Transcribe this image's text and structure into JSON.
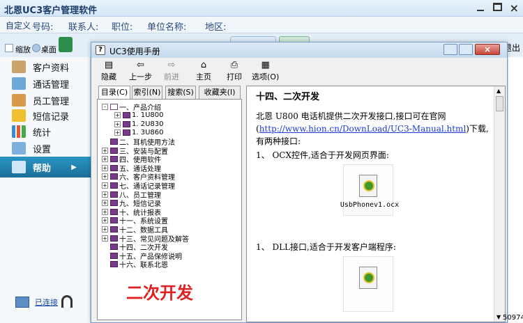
{
  "app": {
    "title": "北恩UC3客户管理软件"
  },
  "search": {
    "customize": "自定义",
    "fields": [
      "号码:",
      "联系人:",
      "职位:",
      "单位名称:",
      "地区:"
    ]
  },
  "toolbar": {
    "zoom_label": "缩放",
    "desktop_label": "桌面",
    "exit_label": "退出"
  },
  "sidebar": {
    "items": [
      {
        "label": "客户资料",
        "icon": "contacts-icon"
      },
      {
        "label": "通话管理",
        "icon": "call-icon"
      },
      {
        "label": "员工管理",
        "icon": "staff-icon"
      },
      {
        "label": "短信记录",
        "icon": "sms-icon"
      },
      {
        "label": "统计",
        "icon": "chart-icon"
      },
      {
        "label": "设置",
        "icon": "settings-icon"
      },
      {
        "label": "帮助",
        "icon": "help-icon",
        "active": true
      }
    ],
    "connected": "已连接"
  },
  "help_window": {
    "title": "UC3使用手册",
    "tools": [
      {
        "label": "隐藏",
        "icon": "hide-icon",
        "enabled": true
      },
      {
        "label": "上一步",
        "icon": "back-arrow-icon",
        "enabled": true
      },
      {
        "label": "前进",
        "icon": "forward-arrow-icon",
        "enabled": false
      },
      {
        "label": "主页",
        "icon": "home-icon",
        "enabled": true
      },
      {
        "label": "打印",
        "icon": "print-icon",
        "enabled": true
      },
      {
        "label": "选项(O)",
        "icon": "options-icon",
        "enabled": true
      }
    ],
    "tabs": [
      "目录(C)",
      "索引(N)",
      "搜索(S)",
      "收藏夹(I)"
    ],
    "tree": [
      {
        "label": "一、产品介绍",
        "level": 0,
        "expander": "-",
        "open": true
      },
      {
        "label": "1. 1U800",
        "level": 1,
        "expander": "+"
      },
      {
        "label": "1. 2U830",
        "level": 1,
        "expander": "+"
      },
      {
        "label": "1. 3U860",
        "level": 1,
        "expander": "+"
      },
      {
        "label": "二、耳机使用方法",
        "level": 0,
        "expander": ""
      },
      {
        "label": "三、安装与配置",
        "level": 0,
        "expander": "+"
      },
      {
        "label": "四、使用软件",
        "level": 0,
        "expander": "+"
      },
      {
        "label": "五、通话处理",
        "level": 0,
        "expander": "+"
      },
      {
        "label": "六、客户资料管理",
        "level": 0,
        "expander": "+"
      },
      {
        "label": "七、通话记录管理",
        "level": 0,
        "expander": "+"
      },
      {
        "label": "八、员工管理",
        "level": 0,
        "expander": "+"
      },
      {
        "label": "九、短信记录",
        "level": 0,
        "expander": "+"
      },
      {
        "label": "十、统计报表",
        "level": 0,
        "expander": "+"
      },
      {
        "label": "十一、系统设置",
        "level": 0,
        "expander": "+"
      },
      {
        "label": "十二、数据工具",
        "level": 0,
        "expander": "+"
      },
      {
        "label": "十三、常见问题及解答",
        "level": 0,
        "expander": "+"
      },
      {
        "label": "十四、二次开发",
        "level": 0,
        "expander": ""
      },
      {
        "label": "十五、产品保修说明",
        "level": 0,
        "expander": ""
      },
      {
        "label": "十六、联系北恩",
        "level": 0,
        "expander": ""
      }
    ],
    "caption": "二次开发",
    "content": {
      "heading": "十四、二次开发",
      "intro_before": "北恩 U800 电话机提供二次开发接口,接口可在官网(",
      "link": "http://www.hion.cn/DownLoad/UC3-Manual.html",
      "intro_after": ")下载,有两种接口:",
      "item1": "1、 OCX控件,适合于开发网页界面:",
      "file1": "UsbPhonev1.ocx",
      "item2": "1、 DLL接口,适合于开发客户端程序:"
    }
  },
  "status": {
    "number": "50974"
  }
}
